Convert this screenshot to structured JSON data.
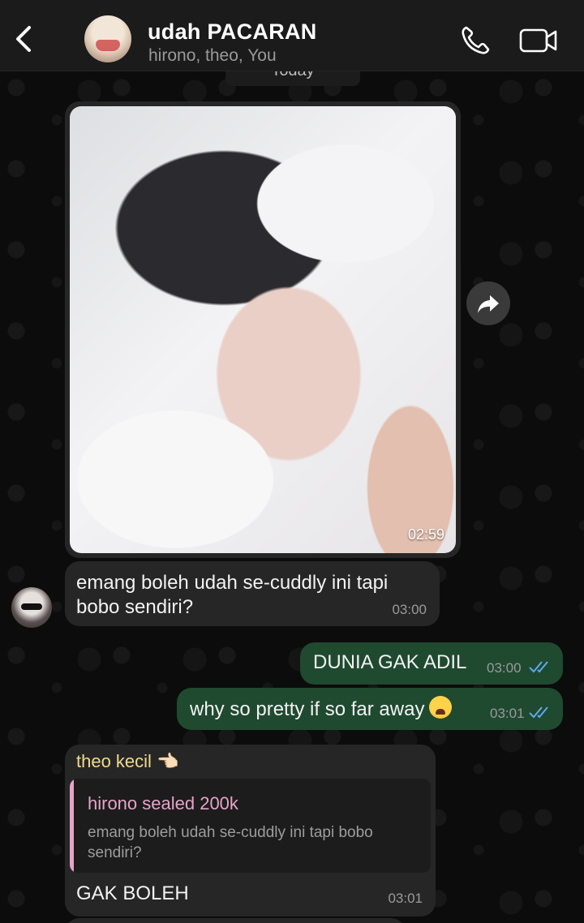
{
  "header": {
    "title": "udah PACARAN",
    "subtitle": "hirono, theo, You"
  },
  "date_chip": "Today",
  "messages": {
    "photo": {
      "time": "02:59"
    },
    "incoming_1": {
      "text": "emang boleh udah se-cuddly ini tapi bobo sendiri?",
      "time": "03:00"
    },
    "outgoing_1": {
      "text": "DUNIA GAK ADIL",
      "time": "03:00"
    },
    "outgoing_2": {
      "text": "why so pretty if so far away",
      "time": "03:01"
    },
    "reply": {
      "sender": "theo kecil 👈🏻",
      "quoted_author": "hirono sealed 200k",
      "quoted_text": "emang boleh udah se-cuddly ini tapi bobo sendiri?",
      "text": "GAK BOLEH",
      "time": "03:01"
    }
  },
  "colors": {
    "outgoing_bubble": "#1f4a30",
    "incoming_bubble": "#262626",
    "read_ticks": "#5fa8e8",
    "reply_sender": "#f2d98c",
    "quote_accent": "#e7a3c8"
  },
  "icons": {
    "back": "chevron-left-icon",
    "call": "phone-icon",
    "video": "video-camera-icon",
    "forward": "forward-arrow-icon",
    "read": "double-check-icon"
  }
}
